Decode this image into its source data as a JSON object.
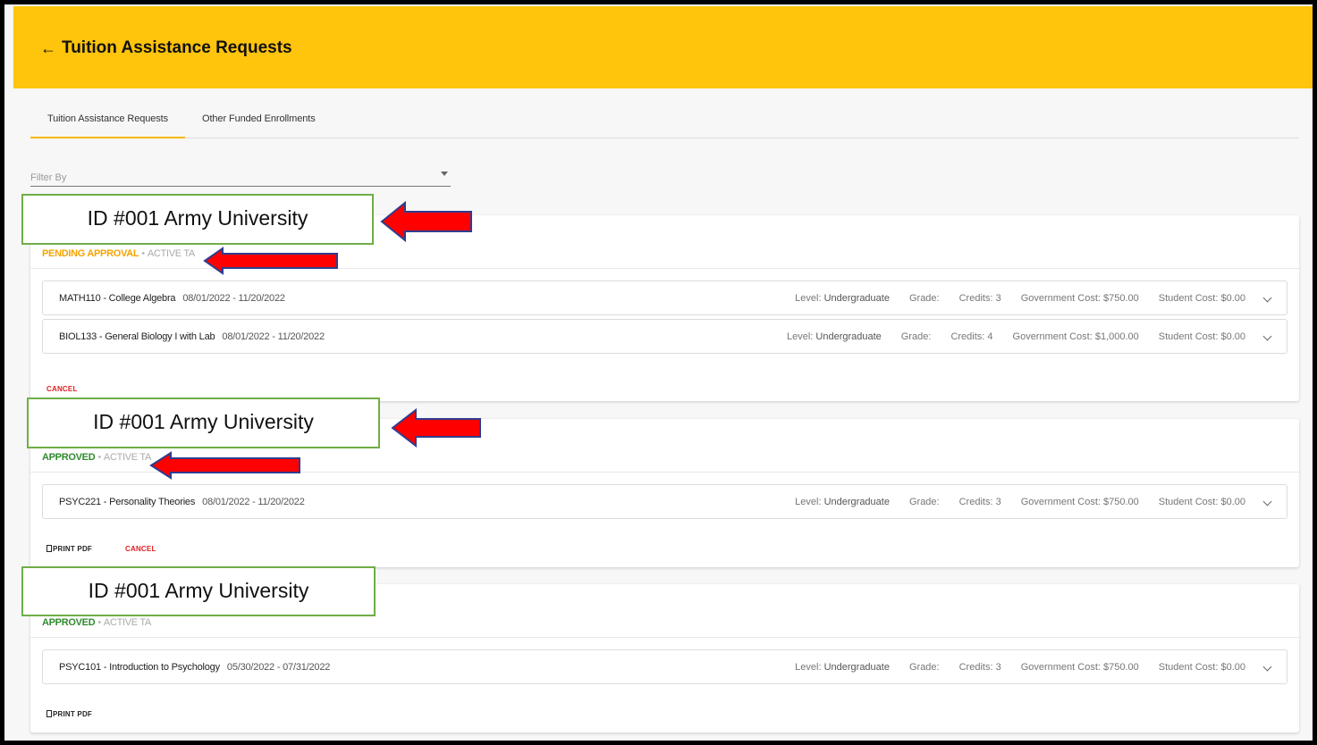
{
  "header": {
    "back_icon": "←",
    "title": "Tuition Assistance Requests"
  },
  "tabs": [
    {
      "label": "Tuition Assistance Requests"
    },
    {
      "label": "Other Funded Enrollments"
    }
  ],
  "filter": {
    "placeholder": "Filter By"
  },
  "annotation": {
    "label": "ID #001 Army University"
  },
  "requests": [
    {
      "status": "PENDING APPROVAL",
      "separator": "•",
      "type": "ACTIVE TA",
      "courses": [
        {
          "name": "MATH110 - College Algebra",
          "dates": "08/01/2022 - 11/20/2022",
          "level_label": "Level:",
          "level": "Undergraduate",
          "grade": "Grade:",
          "credits": "Credits: 3",
          "gov_cost": "Government Cost: $750.00",
          "student_cost": "Student Cost: $0.00"
        },
        {
          "name": "BIOL133 - General Biology I with Lab",
          "dates": "08/01/2022 - 11/20/2022",
          "level_label": "Level:",
          "level": "Undergraduate",
          "grade": "Grade:",
          "credits": "Credits: 4",
          "gov_cost": "Government Cost: $1,000.00",
          "student_cost": "Student Cost: $0.00"
        }
      ],
      "cancel_label": "CANCEL"
    },
    {
      "status": "APPROVED",
      "separator": "•",
      "type": "ACTIVE TA",
      "courses": [
        {
          "name": "PSYC221 - Personality Theories",
          "dates": "08/01/2022 - 11/20/2022",
          "level_label": "Level:",
          "level": "Undergraduate",
          "grade": "Grade:",
          "credits": "Credits: 3",
          "gov_cost": "Government Cost: $750.00",
          "student_cost": "Student Cost: $0.00"
        }
      ],
      "print_label": "PRINT PDF",
      "cancel_label": "CANCEL"
    },
    {
      "status": "APPROVED",
      "separator": "•",
      "type": "ACTIVE TA",
      "courses": [
        {
          "name": "PSYC101 - Introduction to Psychology",
          "dates": "05/30/2022 - 07/31/2022",
          "level_label": "Level:",
          "level": "Undergraduate",
          "grade": "Grade:",
          "credits": "Credits: 3",
          "gov_cost": "Government Cost: $750.00",
          "student_cost": "Student Cost: $0.00"
        }
      ],
      "print_label": "PRINT PDF"
    }
  ],
  "colors": {
    "header_bg": "#ffc40c",
    "pending": "#f5a300",
    "approved": "#2e8b2e",
    "cancel": "#e02020",
    "annotation_border": "#70ad47",
    "annotation_arrow": "#ff0000"
  }
}
